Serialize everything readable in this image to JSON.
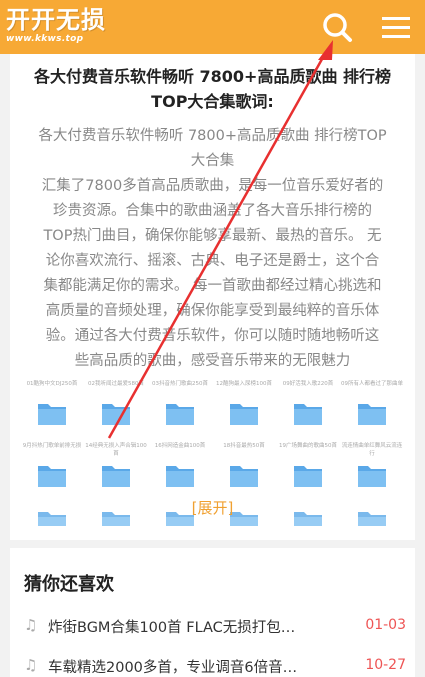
{
  "header": {
    "logo_text": "开开无损",
    "logo_url": "www.kkws.top",
    "search_icon": "search-icon",
    "menu_icon": "hamburger-menu-icon",
    "brand_color": "#f7a935"
  },
  "article": {
    "title_line1": "各大付费音乐软件畅听 7800+高品质歌曲 排行榜",
    "title_line2": "TOP大合集歌词:",
    "body_lines": [
      "各大付费音乐软件畅听 7800+高品质歌曲 排行榜TOP",
      "大合集",
      "汇集了7800多首高品质歌曲，是每一位音乐爱好者的",
      "珍贵资源。合集中的歌曲涵盖了各大音乐排行榜的",
      "TOP热门曲目，确保你能够享最新、最热的音乐。 无",
      "论你喜欢流行、摇滚、古典、电子还是爵士，这个合",
      "集都能满足你的需求。 每一首歌曲都经过精心挑选和",
      "高质量的音频处理，确保你能享受到最纯粹的音乐体",
      "验。通过各大付费音乐软件，你可以随时随地畅听这",
      "些高品质的歌曲，感受音乐带来的无限魅力"
    ],
    "folders_row1": [
      "01酷狗中文DJ250首",
      "02我听闻过最爱580首",
      "03抖音热门歌曲250首",
      "12酷狗最入尿榜100首",
      "09好活我入歌220首",
      "09所有人都看过了那曲单"
    ],
    "folders_row2": [
      "9月抖热门歌单前排无损",
      "14经典无损入声合辑100首",
      "16抖网造金曲100首",
      "18抖音最热50首",
      "19广场舞曲的歌曲50首",
      "流连情曲单红舞风云流连行"
    ],
    "expand_label": "[展开]"
  },
  "recommend": {
    "heading": "猜你还喜欢",
    "items": [
      {
        "title": "炸街BGM合集100首 FLAC无损打包…",
        "date": "01-03"
      },
      {
        "title": "车载精选2000多首，专业调音6倍音…",
        "date": "10-27"
      }
    ]
  },
  "colors": {
    "accent": "#f7a935",
    "date_red": "#e55555",
    "expand_orange": "#f0a030",
    "annotation_arrow": "#e83030"
  }
}
